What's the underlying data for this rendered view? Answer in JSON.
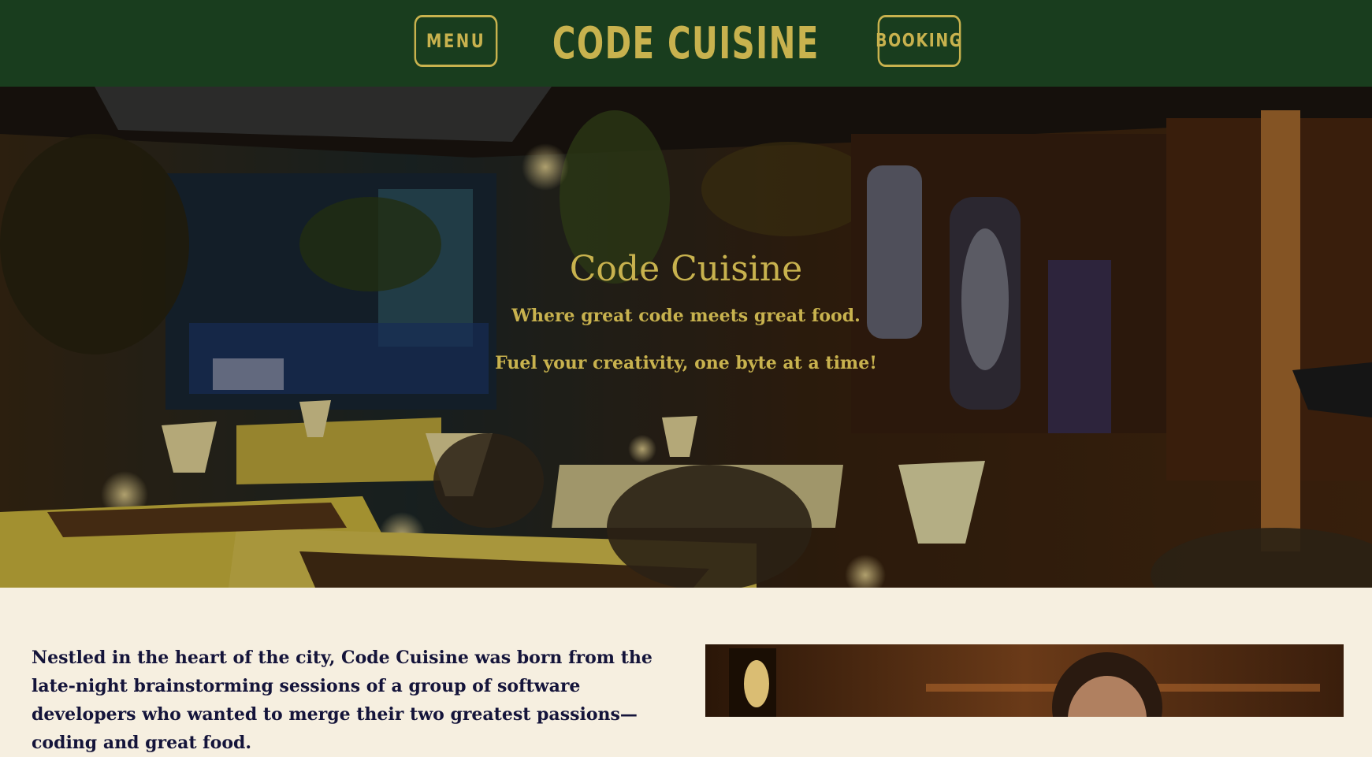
{
  "header": {
    "menu_label": "MENU",
    "brand": "CODE CUISINE",
    "booking_label": "BOOKING",
    "background": "#193d1e",
    "accent": "#c8b24e"
  },
  "hero": {
    "title": "Code Cuisine",
    "tagline": "Where great code meets great food.",
    "subtitle": "Fuel your creativity, one byte at a time!"
  },
  "about": {
    "text": "Nestled in the heart of the city, Code Cuisine was born from the late-night brainstorming sessions of a group of software developers who wanted to merge their two greatest passions—coding and great food."
  }
}
